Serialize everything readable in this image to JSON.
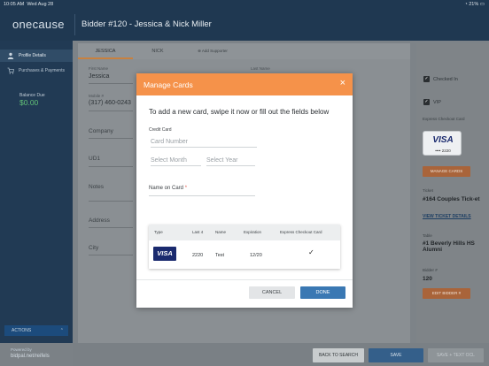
{
  "status": {
    "time": "10:05 AM",
    "date": "Wed Aug 28",
    "battery": "21%"
  },
  "header": {
    "logo": "onecause",
    "title": "Bidder #120 - Jessica & Nick Miller"
  },
  "sidebar": {
    "items": [
      {
        "label": "Profile Details"
      },
      {
        "label": "Purchases & Payments"
      }
    ],
    "balance_label": "Balance Due",
    "balance_value": "$0.00",
    "actions_label": "ACTIONS",
    "powered_by": "Powered by",
    "powered_url": "bidpal.net/reifels"
  },
  "tabs": [
    {
      "label": "JESSICA"
    },
    {
      "label": "NICK"
    },
    {
      "label": "Add Supporter"
    }
  ],
  "form": {
    "first_name_label": "First Name",
    "first_name_value": "Jessica",
    "last_name_label": "Last Name",
    "mobile_label": "Mobile #",
    "mobile_value": "(317) 460-0243",
    "company_label": "Company",
    "ud1_label": "UD1",
    "notes_label": "Notes",
    "address_label": "Address",
    "city_label": "City"
  },
  "right_panel": {
    "checked_in_label": "Checked In",
    "vip_label": "VIP",
    "express_checkout_label": "Express Checkout Card",
    "card_brand": "VISA",
    "card_last4": "•••• 2220",
    "manage_cards_button": "MANAGE CARDS",
    "ticket_label": "Ticket",
    "ticket_value": "#164 Couples Tick-et",
    "view_ticket_details": "VIEW TICKET DETAILS",
    "table_label": "Table",
    "table_value": "#1 Beverly Hills HS Alumni",
    "bidder_label": "Bidder #",
    "bidder_value": "120",
    "edit_bidder_button": "EDIT BIDDER #"
  },
  "bottom_bar": {
    "back_to_search": "BACK TO SEARCH",
    "save": "SAVE",
    "save_text_ocl": "SAVE + TEXT OCL"
  },
  "modal": {
    "title": "Manage Cards",
    "close": "×",
    "intro": "To add a new card, swipe it now or fill out the fields below",
    "credit_card_label": "Credit Card",
    "card_number_placeholder": "Card Number",
    "select_month_placeholder": "Select Month",
    "select_year_placeholder": "Select Year",
    "name_on_card_label": "Name on Card",
    "required_mark": "*",
    "table": {
      "headers": [
        "Type",
        "Last 4",
        "Name",
        "Expiration",
        "Express Checkout Card"
      ],
      "rows": [
        {
          "type": "VISA",
          "last4": "2220",
          "name": "Test",
          "expiration": "12/20",
          "express": "✓"
        }
      ]
    },
    "cancel_button": "CANCEL",
    "done_button": "DONE"
  },
  "colors": {
    "header_bg": "#1f3851",
    "modal_header": "#f5924a",
    "primary_button": "#3a78b3",
    "accent_orange": "#c8813f"
  }
}
